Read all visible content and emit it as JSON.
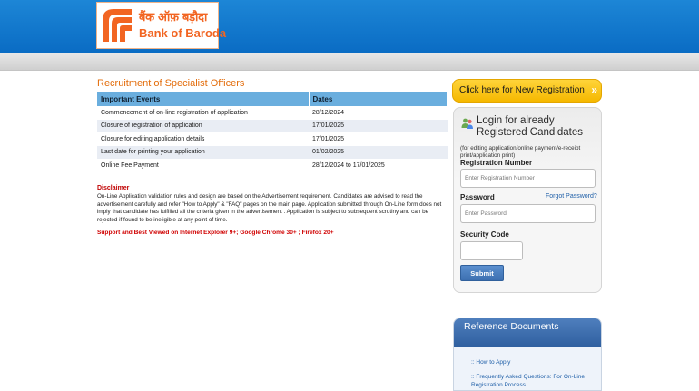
{
  "brand": {
    "name_hindi": "बैंक ऑफ़ बड़ौदा",
    "name_english": "Bank of Baroda",
    "color": "#f26522"
  },
  "main": {
    "title": "Recruitment of Specialist Officers",
    "table": {
      "headers": [
        "Important Events",
        "Dates"
      ],
      "rows": [
        [
          "Commencement of on-line registration of application",
          "28/12/2024"
        ],
        [
          "Closure of registration of application",
          "17/01/2025"
        ],
        [
          "Closure for editing application details",
          "17/01/2025"
        ],
        [
          "Last date for printing your application",
          "01/02/2025"
        ],
        [
          "Online Fee Payment",
          "28/12/2024 to 17/01/2025"
        ]
      ]
    },
    "disclaimer_title": "Disclaimer",
    "disclaimer_text": "On-Line Application validation rules and design are based on the Advertisement requirement. Candidates are advised to read the advertisement carefully and refer \"How to Apply\" & \"FAQ\" pages on the main page. Application submitted through On-Line form does not imply that candidate has fulfilled all the criteria given in the advertisement . Application is subject to subsequent scrutiny and can be rejected if found to be ineligible at any point of time.",
    "support_text": "Support and Best Viewed on Internet Explorer 9+; Google Chrome 30+ ; Firefox 20+"
  },
  "new_registration": {
    "label": "Click here for New Registration",
    "arrows": "»"
  },
  "login": {
    "title": "Login for already Registered Candidates",
    "note": "(for editing application/online payment/e-receipt print/application print)",
    "registration_label": "Registration Number",
    "registration_placeholder": "Enter Registration Number",
    "password_label": "Password",
    "forgot_label": "Forgot Password?",
    "password_placeholder": "Enter Password",
    "security_label": "Security Code",
    "submit_label": "Submit"
  },
  "reference": {
    "title": "Reference Documents",
    "links": [
      ":: How to Apply",
      ":: Frequently Asked Questions: For On-Line Registration Process."
    ]
  }
}
